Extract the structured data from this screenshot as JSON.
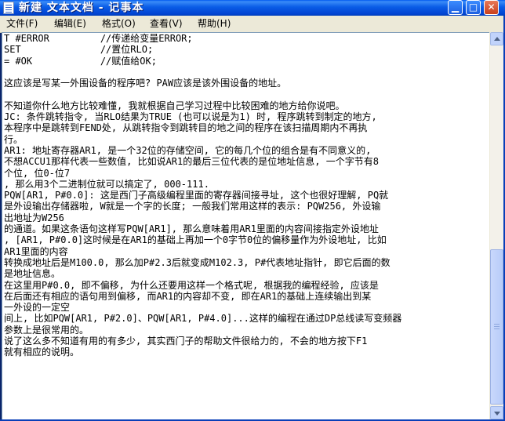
{
  "window": {
    "title": "新建 文本文档 - 记事本",
    "icon": "notepad-icon",
    "controls": [
      "minimize-icon",
      "maximize-icon",
      "close-icon"
    ],
    "accent": "#0A5CE6"
  },
  "menu": [
    {
      "label": "文件(F)"
    },
    {
      "label": "编辑(E)"
    },
    {
      "label": "格式(O)"
    },
    {
      "label": "查看(V)"
    },
    {
      "label": "帮助(H)"
    }
  ],
  "editor": {
    "lines": [
      "T #ERROR         //传递给变量ERROR;",
      "SET              //置位RLO;",
      "= #OK            //赋值给OK;",
      "",
      "这应该是写某一外围设备的程序吧? PAW应该是该外围设备的地址。",
      "",
      "不知道你什么地方比较难懂, 我就根据自己学习过程中比较困难的地方给你说吧。",
      "JC: 条件跳转指令, 当RLO结果为TRUE (也可以说是为1) 时, 程序跳转到制定的地方,",
      "本程序中是跳转到FEND处, 从跳转指令到跳转目的地之间的程序在该扫描周期内不再执",
      "行。",
      "AR1: 地址寄存器AR1, 是一个32位的存储空间, 它的每几个位的组合是有不同意义的,",
      "不想ACCU1那样代表一些数值, 比如说AR1的最后三位代表的是位地址信息, 一个字节有8",
      "个位, 位0-位7",
      ", 那么用3个二进制位就可以搞定了, 000-111.",
      "PQW[AR1, P#0.0]: 这是西门子高级编程里面的寄存器间接寻址, 这个也很好理解, PQ就",
      "是外设输出存储器啦, W就是一个字的长度; 一般我们常用这样的表示: PQW256, 外设输",
      "出地址为W256",
      "的通道。如果这条语句这样写PQW[AR1], 那么意味着用AR1里面的内容间接指定外设地址",
      ", [AR1, P#0.0]这时候是在AR1的基础上再加一个0字节0位的偏移量作为外设地址, 比如",
      "AR1里面的内容",
      "转换成地址后是M100.0, 那么加P#2.3后就变成M102.3, P#代表地址指针, 即它后面的数",
      "是地址信息。",
      "在这里用P#0.0, 即不偏移, 为什么还要用这样一个格式呢, 根据我的编程经验, 应该是",
      "在后面还有相应的语句用到偏移, 而AR1的内容却不变, 即在AR1的基础上连续输出到某",
      "一外设的一定空",
      "间上, 比如PQW[AR1, P#2.0]、PQW[AR1, P#4.0]...这样的编程在通过DP总线读写变频器",
      "参数上是很常用的。",
      "说了这么多不知道有用的有多少, 其实西门子的帮助文件很给力的, 不会的地方按下F1",
      "就有相应的说明。"
    ]
  },
  "scrollbar": {
    "up_icon": "scroll-up-arrow-icon",
    "down_icon": "scroll-down-arrow-icon",
    "position": 0.95
  }
}
